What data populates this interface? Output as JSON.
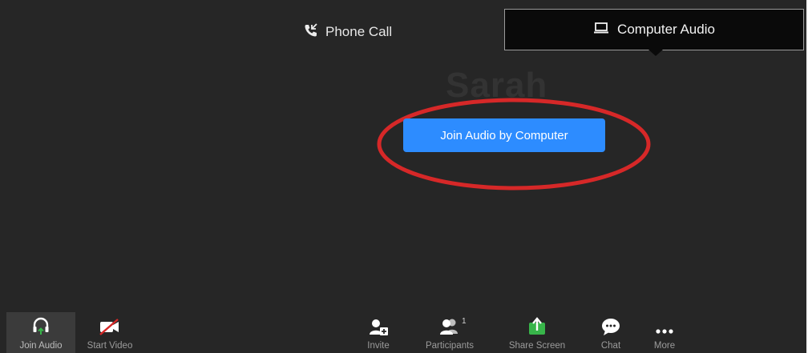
{
  "audio_tabs": {
    "phone_call": "Phone Call",
    "computer_audio": "Computer Audio"
  },
  "background_name": "Sarah",
  "join_button": "Join Audio by Computer",
  "toolbar": {
    "join_audio": "Join Audio",
    "start_video": "Start Video",
    "invite": "Invite",
    "participants": "Participants",
    "participants_count": "1",
    "share_screen": "Share Screen",
    "chat": "Chat",
    "more": "More"
  },
  "colors": {
    "background": "#262626",
    "button_blue": "#2d8cff",
    "highlight_red": "#d62828",
    "share_green": "#38b54a"
  },
  "icons": [
    "phone-icon",
    "laptop-icon",
    "headphones-icon",
    "video-off-icon",
    "invite-icon",
    "participants-icon",
    "share-screen-icon",
    "chat-icon",
    "more-icon"
  ]
}
